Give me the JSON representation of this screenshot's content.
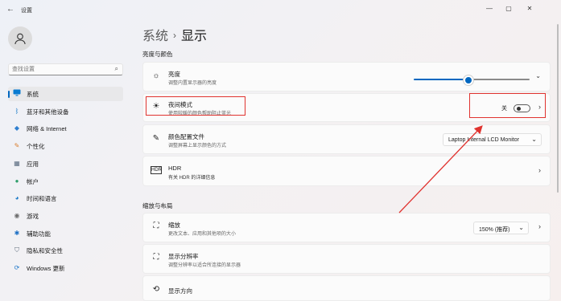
{
  "window": {
    "title": "设置",
    "back_icon": "back-arrow-icon",
    "min": "—",
    "max": "▢",
    "close": "✕"
  },
  "sidebar": {
    "search_placeholder": "查找设置",
    "items": [
      {
        "label": "系统",
        "icon": "monitor-icon",
        "active": true
      },
      {
        "label": "蓝牙和其他设备",
        "icon": "bluetooth-icon"
      },
      {
        "label": "网络 & Internet",
        "icon": "network-icon"
      },
      {
        "label": "个性化",
        "icon": "brush-icon"
      },
      {
        "label": "应用",
        "icon": "apps-icon"
      },
      {
        "label": "帐户",
        "icon": "account-icon"
      },
      {
        "label": "时间和语言",
        "icon": "globe-clock-icon"
      },
      {
        "label": "游戏",
        "icon": "gamepad-icon"
      },
      {
        "label": "辅助功能",
        "icon": "accessibility-icon"
      },
      {
        "label": "隐私和安全性",
        "icon": "shield-icon"
      },
      {
        "label": "Windows 更新",
        "icon": "update-icon"
      }
    ]
  },
  "breadcrumb": {
    "parent": "系统",
    "separator": "›",
    "current": "显示"
  },
  "sections": {
    "brightness_color": "亮度与颜色",
    "scale_layout": "缩放与布局"
  },
  "settings": {
    "brightness": {
      "title": "亮度",
      "subtitle": "调整内置显示器的亮度",
      "value_fraction": 0.47
    },
    "night_light": {
      "title": "夜间模式",
      "subtitle": "使用较暖的颜色帮助阻止蓝光",
      "state": "关"
    },
    "color_profile": {
      "title": "颜色配置文件",
      "subtitle": "调整屏幕上显示颜色的方式",
      "value": "Laptop Internal LCD Monitor"
    },
    "hdr": {
      "title": "HDR",
      "subtitle": "有关 HDR 的详细信息"
    },
    "scale": {
      "title": "缩放",
      "subtitle": "更改文本、应用和其他项的大小",
      "value": "150% (推荐)"
    },
    "resolution": {
      "title": "显示分辨率",
      "subtitle": "调整分辨率以适合所连接的显示器"
    },
    "orientation": {
      "title": "显示方向"
    }
  },
  "annotation_color": "#e0332f",
  "accent_color": "#0067c0"
}
